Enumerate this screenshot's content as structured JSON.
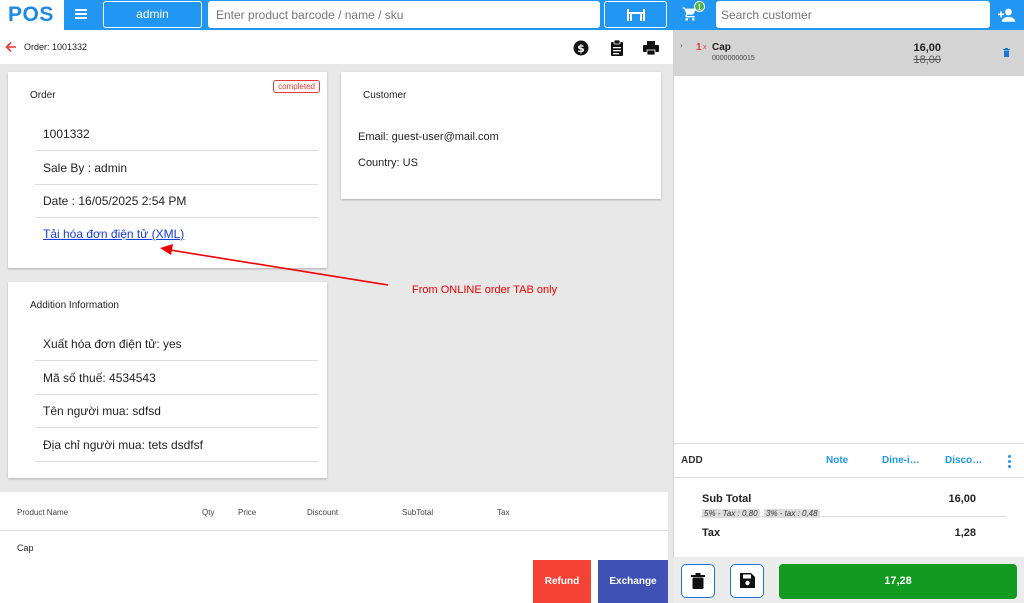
{
  "app": {
    "logo": "POS",
    "user": "admin"
  },
  "search": {
    "product_placeholder": "Enter product barcode / name / sku",
    "customer_placeholder": "Search customer"
  },
  "cart_badge": "1",
  "order": {
    "header": "Order: 1001332"
  },
  "order_card": {
    "title": "Order",
    "status": "completed",
    "id": "1001332",
    "sale_by": "Sale By : admin",
    "date": "Date : 16/05/2025 2:54 PM",
    "xml_link": "Tải hóa đơn điện tử (XML)"
  },
  "customer_card": {
    "title": "Customer",
    "email": "Email: guest-user@mail.com",
    "country": "Country: US"
  },
  "addition_card": {
    "title": "Addition Information",
    "rows": [
      "Xuất hóa đơn điện tử: yes",
      "Mã số thuế: 4534543",
      "Tên người mua: sdfsd",
      "Địa chỉ người mua: tets dsdfsf"
    ]
  },
  "annotation": "From ONLINE order TAB only",
  "product_table": {
    "columns": [
      "Product Name",
      "Qty",
      "Price",
      "Discount",
      "SubTotal",
      "Tax"
    ],
    "rows": [
      {
        "name": "Cap"
      }
    ]
  },
  "buttons": {
    "refund": "Refund",
    "exchange": "Exchange"
  },
  "cart": {
    "item": {
      "qty": "1",
      "x": "x",
      "name": "Cap",
      "sku": "00000000015",
      "price": "16,00",
      "old_price": "18,00"
    },
    "actions": {
      "add": "ADD",
      "note": "Note",
      "dine": "Dine-i…",
      "discount": "Disco…"
    },
    "subtotal_label": "Sub Total",
    "subtotal": "16,00",
    "tax_label": "Tax",
    "tax": "1,28",
    "tax_details": [
      "5% - Tax : 0,80",
      "3% - tax : 0,48"
    ],
    "pay": "17,28"
  },
  "colors": {
    "primary": "#2196f3",
    "refund": "#f44336",
    "exchange": "#3f51b5",
    "pay": "#119a1f",
    "badge": "#e53935"
  }
}
